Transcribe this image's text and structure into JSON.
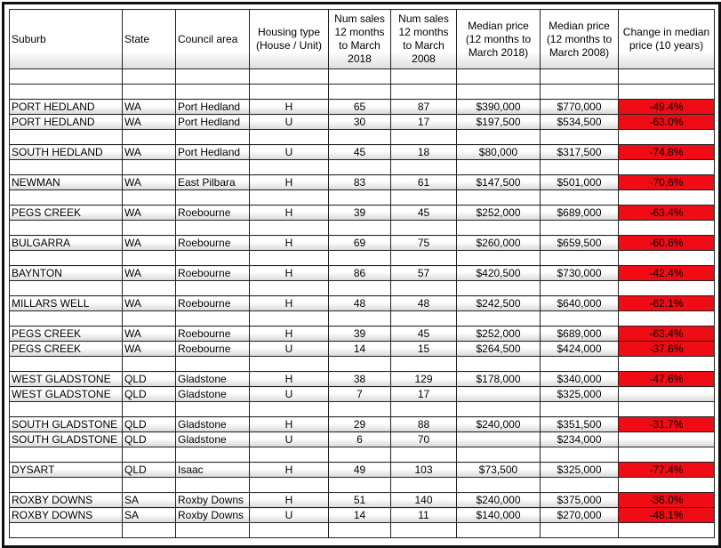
{
  "headers": [
    "Suburb",
    "State",
    "Council area",
    "Housing type (House / Unit)",
    "Num sales 12 months to March 2018",
    "Num sales 12 months to March 2008",
    "Median price (12 months to March 2018)",
    "Median price (12 months to March 2008)",
    "Change in median price (10 years)"
  ],
  "colors": {
    "negative_change": "#f00c14"
  },
  "rows": [
    null,
    null,
    [
      "PORT HEDLAND",
      "WA",
      "Port Hedland",
      "H",
      "65",
      "87",
      "$390,000",
      "$770,000",
      "-49.4%"
    ],
    [
      "PORT HEDLAND",
      "WA",
      "Port Hedland",
      "U",
      "30",
      "17",
      "$197,500",
      "$534,500",
      "-63.0%"
    ],
    null,
    [
      "SOUTH HEDLAND",
      "WA",
      "Port Hedland",
      "U",
      "45",
      "18",
      "$80,000",
      "$317,500",
      "-74.8%"
    ],
    null,
    [
      "NEWMAN",
      "WA",
      "East Pilbara",
      "H",
      "83",
      "61",
      "$147,500",
      "$501,000",
      "-70.6%"
    ],
    null,
    [
      "PEGS CREEK",
      "WA",
      "Roebourne",
      "H",
      "39",
      "45",
      "$252,000",
      "$689,000",
      "-63.4%"
    ],
    null,
    [
      "BULGARRA",
      "WA",
      "Roebourne",
      "H",
      "69",
      "75",
      "$260,000",
      "$659,500",
      "-60.6%"
    ],
    null,
    [
      "BAYNTON",
      "WA",
      "Roebourne",
      "H",
      "86",
      "57",
      "$420,500",
      "$730,000",
      "-42.4%"
    ],
    null,
    [
      "MILLARS WELL",
      "WA",
      "Roebourne",
      "H",
      "48",
      "48",
      "$242,500",
      "$640,000",
      "-62.1%"
    ],
    null,
    [
      "PEGS CREEK",
      "WA",
      "Roebourne",
      "H",
      "39",
      "45",
      "$252,000",
      "$689,000",
      "-63.4%"
    ],
    [
      "PEGS CREEK",
      "WA",
      "Roebourne",
      "U",
      "14",
      "15",
      "$264,500",
      "$424,000",
      "-37.6%"
    ],
    null,
    [
      "WEST GLADSTONE",
      "QLD",
      "Gladstone",
      "H",
      "38",
      "129",
      "$178,000",
      "$340,000",
      "-47.6%"
    ],
    [
      "WEST GLADSTONE",
      "QLD",
      "Gladstone",
      "U",
      "7",
      "17",
      "",
      "$325,000",
      ""
    ],
    null,
    [
      "SOUTH GLADSTONE",
      "QLD",
      "Gladstone",
      "H",
      "29",
      "88",
      "$240,000",
      "$351,500",
      "-31.7%"
    ],
    [
      "SOUTH GLADSTONE",
      "QLD",
      "Gladstone",
      "U",
      "6",
      "70",
      "",
      "$234,000",
      ""
    ],
    null,
    [
      "DYSART",
      "QLD",
      "Isaac",
      "H",
      "49",
      "103",
      "$73,500",
      "$325,000",
      "-77.4%"
    ],
    null,
    [
      "ROXBY DOWNS",
      "SA",
      "Roxby Downs",
      "H",
      "51",
      "140",
      "$240,000",
      "$375,000",
      "-36.0%"
    ],
    [
      "ROXBY DOWNS",
      "SA",
      "Roxby Downs",
      "U",
      "14",
      "11",
      "$140,000",
      "$270,000",
      "-48.1%"
    ],
    null
  ]
}
